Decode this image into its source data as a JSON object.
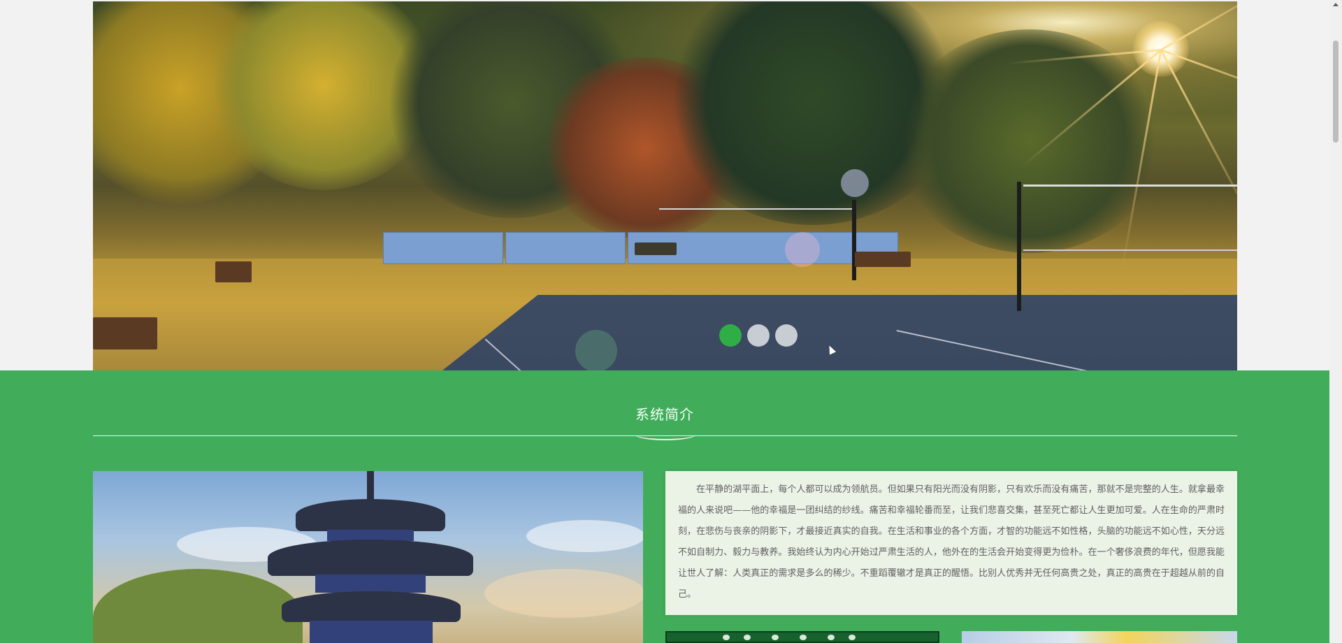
{
  "carousel": {
    "slide_count": 3,
    "active_index": 0,
    "indicator_colors": {
      "active": "#2fae46",
      "inactive": "#ffffff"
    }
  },
  "intro": {
    "title": "系统简介",
    "paragraph": "在平静的湖平面上，每个人都可以成为领航员。但如果只有阳光而没有阴影，只有欢乐而没有痛苦，那就不是完整的人生。就拿最幸福的人来说吧——他的幸福是一团纠结的纱线。痛苦和幸福轮番而至，让我们悲喜交集，甚至死亡都让人生更加可爱。人在生命的严肃时刻，在悲伤与丧亲的阴影下，才最接近真实的自我。在生活和事业的各个方面，才智的功能远不如性格，头脑的功能远不如心性，天分远不如自制力、毅力与教养。我始终认为内心开始过严肃生活的人，他外在的生活会开始变得更为俭朴。在一个奢侈浪费的年代，但愿我能让世人了解：人类真正的需求是多么的稀少。不重蹈覆辙才是真正的醒悟。比别人优秀并无任何高贵之处，真正的高贵在于超越从前的自己。",
    "background_color": "#41ad5b"
  },
  "icons": [
    "carousel-indicator",
    "mouse-cursor-icon",
    "scroll-up-arrow-icon"
  ]
}
